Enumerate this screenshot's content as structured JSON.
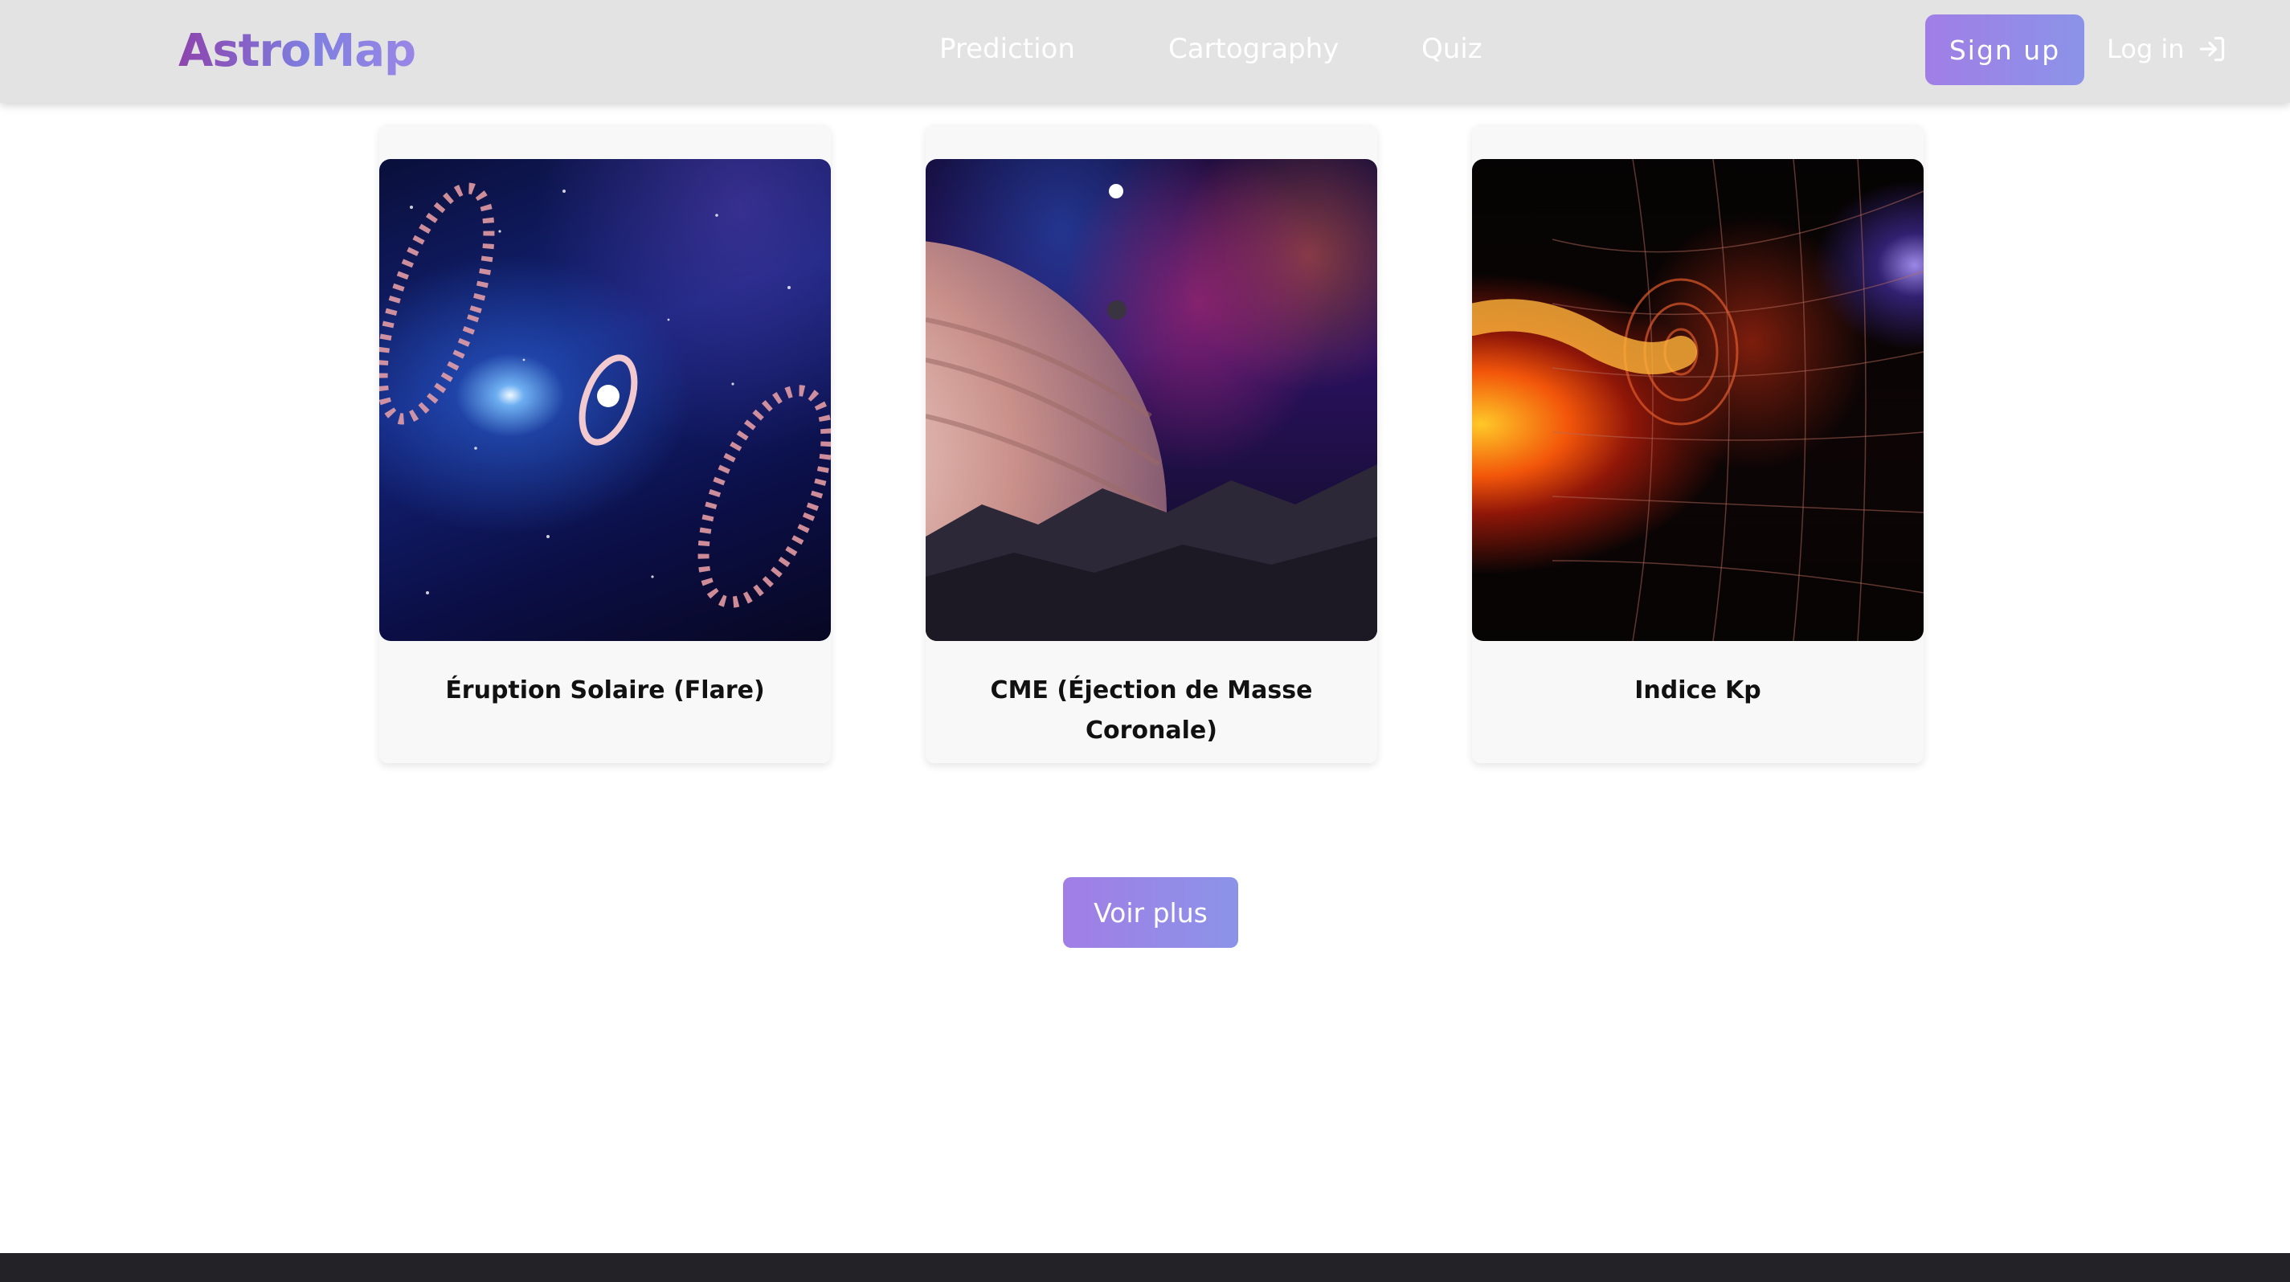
{
  "header": {
    "logo": "AstroMap",
    "nav": [
      "Prediction",
      "Cartography",
      "Quiz"
    ],
    "signup_label": "Sign up",
    "login_label": "Log in"
  },
  "cards": [
    {
      "title": "Éruption Solaire (Flare)"
    },
    {
      "title": "CME (Éjection de Masse Coronale)"
    },
    {
      "title": "Indice Kp"
    }
  ],
  "more_button": "Voir plus",
  "colors": {
    "header_bg": "#e3e3e3",
    "accent_start": "#a17ee6",
    "accent_end": "#8b93e8",
    "footer_bg": "#232327"
  },
  "icons": {
    "login": "login-arrow-icon"
  }
}
